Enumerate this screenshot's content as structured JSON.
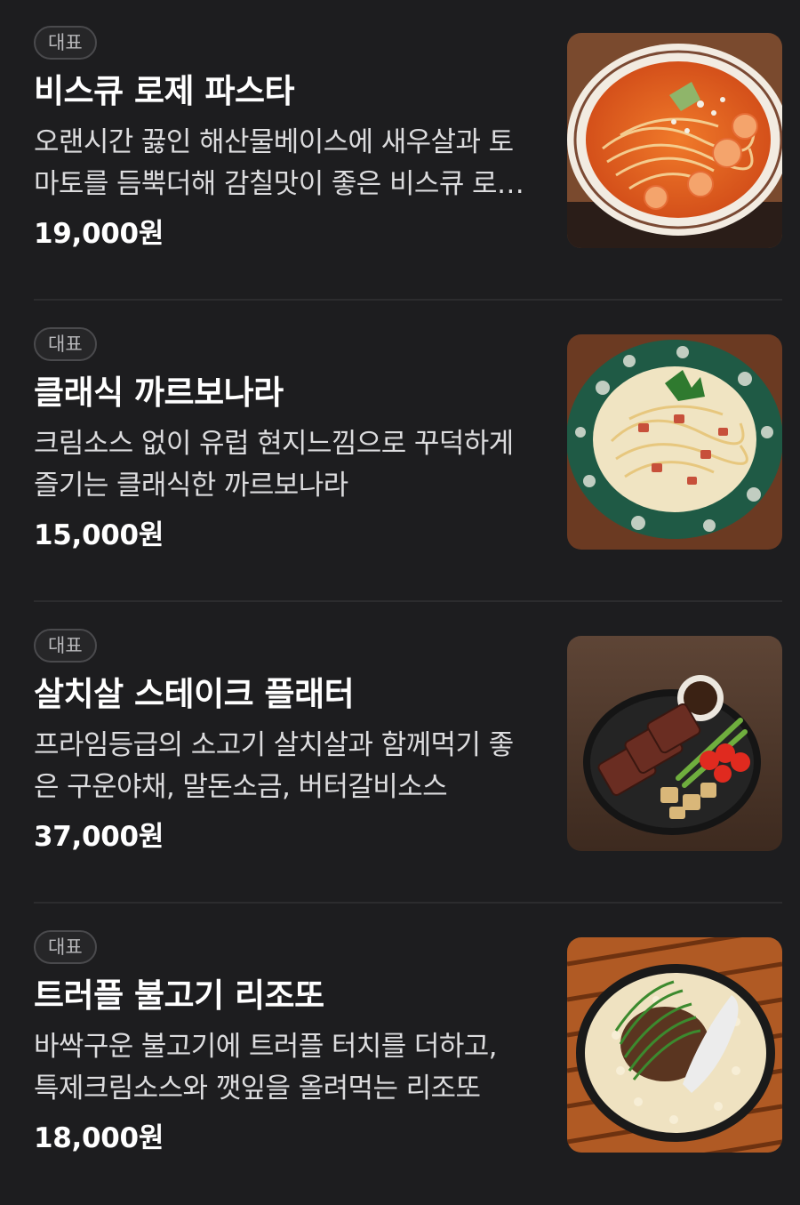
{
  "menu": [
    {
      "badge": "대표",
      "name": "비스큐 로제 파스타",
      "description": "오랜시간 끓인 해산물베이스에 새우살과 토마토를 듬뿍더해 감칠맛이 좋은 비스큐 로제 파스타",
      "price": "19,000원",
      "image_icon": "rose-pasta-image"
    },
    {
      "badge": "대표",
      "name": "클래식 까르보나라",
      "description": "크림소스 없이 유럽 현지느낌으로 꾸덕하게 즐기는 클래식한 까르보나라",
      "price": "15,000원",
      "image_icon": "carbonara-image"
    },
    {
      "badge": "대표",
      "name": "살치살 스테이크 플래터",
      "description": "프라임등급의 소고기 살치살과 함께먹기 좋은 구운야채, 말돈소금, 버터갈비소스",
      "price": "37,000원",
      "image_icon": "steak-platter-image"
    },
    {
      "badge": "대표",
      "name": "트러플 불고기 리조또",
      "description": "바싹구운 불고기에 트러플 터치를 더하고, 특제크림소스와 깻잎을 올려먹는 리조또",
      "price": "18,000원",
      "image_icon": "bulgogi-risotto-image"
    }
  ],
  "colors": {
    "background": "#1d1d1f",
    "divider": "#2c2c2e",
    "text_primary": "#ffffff",
    "text_secondary": "#dcdcde"
  }
}
